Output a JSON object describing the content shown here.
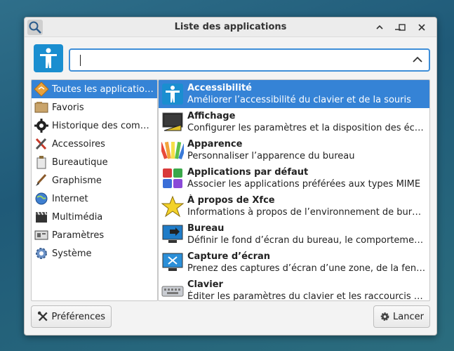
{
  "window": {
    "title": "Liste des applications"
  },
  "search": {
    "value": "",
    "placeholder": ""
  },
  "categories": [
    {
      "label": "Toutes les applicatio…",
      "icon": "all-apps-icon",
      "selected": true
    },
    {
      "label": "Favoris",
      "icon": "favorites-icon"
    },
    {
      "label": "Historique des com…",
      "icon": "history-icon"
    },
    {
      "label": "Accessoires",
      "icon": "accessories-icon"
    },
    {
      "label": "Bureautique",
      "icon": "office-icon"
    },
    {
      "label": "Graphisme",
      "icon": "graphics-icon"
    },
    {
      "label": "Internet",
      "icon": "internet-icon"
    },
    {
      "label": "Multimédia",
      "icon": "multimedia-icon"
    },
    {
      "label": "Paramètres",
      "icon": "settings-icon"
    },
    {
      "label": "Système",
      "icon": "system-icon"
    }
  ],
  "apps": [
    {
      "name": "Accessibilité",
      "desc": "Améliorer l’accessibilité du clavier et de la souris",
      "icon": "accessibility-icon",
      "selected": true
    },
    {
      "name": "Affichage",
      "desc": "Configurer les paramètres et la disposition des éc…",
      "icon": "display-icon"
    },
    {
      "name": "Apparence",
      "desc": "Personnaliser l’apparence du bureau",
      "icon": "appearance-icon"
    },
    {
      "name": "Applications par défaut",
      "desc": "Associer les applications préférées aux types MIME",
      "icon": "default-apps-icon"
    },
    {
      "name": "À propos de Xfce",
      "desc": "Informations à propos de l’environnement de bur…",
      "icon": "about-xfce-icon"
    },
    {
      "name": "Bureau",
      "desc": "Définir le fond d’écran du bureau, le comporteme…",
      "icon": "desktop-icon"
    },
    {
      "name": "Capture d’écran",
      "desc": "Prenez des captures d’écran d’une zone, de la fen…",
      "icon": "screenshot-icon"
    },
    {
      "name": "Clavier",
      "desc": "Éditer les paramètres du clavier et les raccourcis …",
      "icon": "keyboard-icon"
    }
  ],
  "buttons": {
    "preferences": "Préférences",
    "launch": "Lancer"
  },
  "colors": {
    "accent": "#3583d6",
    "accessibility_blue": "#1a8ed0"
  }
}
